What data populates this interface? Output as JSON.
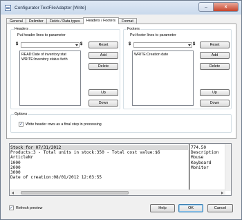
{
  "window": {
    "title": "Configurator TextFileAdapter  [Write]",
    "minimize_glyph": "–",
    "close_glyph": "×"
  },
  "tabs": [
    "General",
    "Delimiter",
    "Fields / Data types",
    "Headers / Footers",
    "Format"
  ],
  "active_tab_index": 3,
  "headers": {
    "group_title": "Headers",
    "put_label": "Put header lines to parameter",
    "dollar_left": "$",
    "dollar_right": "$",
    "lines": [
      "READ:Date of inventory:stat",
      "WRITE:Inventory status furth"
    ],
    "buttons": {
      "reset": "Reset",
      "add": "Add",
      "delete": "Delete",
      "up": "Up",
      "down": "Down"
    }
  },
  "footers": {
    "group_title": "Footers",
    "put_label": "Put footer lines to parameter",
    "dollar_left": "$",
    "dollar_right": "$",
    "lines": [
      "WRITE:Creation date"
    ],
    "buttons": {
      "reset": "Reset",
      "add": "Add",
      "delete": "Delete",
      "up": "Up",
      "down": "Down"
    }
  },
  "options": {
    "group_title": "Options",
    "write_header_last": {
      "label": "Write header rows as a final step in processing",
      "checked": true,
      "check_glyph": "✓"
    }
  },
  "preview": {
    "left_lines": [
      "Stock for 07/31/2012",
      "Products:3 - Total units in stock:350 - Total cost value:$6",
      "ArticleNr",
      "1000",
      "2000",
      "3000",
      "Date of creation:08/01/2012 12:03:55"
    ],
    "right_lines": [
      "",
      "774.50",
      "Description",
      "Mouse",
      "Keyboard",
      "Monitor",
      ""
    ]
  },
  "refresh_preview": {
    "label": "Refresh preview",
    "checked": true,
    "check_glyph": "✓"
  },
  "footer_buttons": {
    "help": "Help",
    "ok": "OK",
    "cancel": "Cancel"
  }
}
